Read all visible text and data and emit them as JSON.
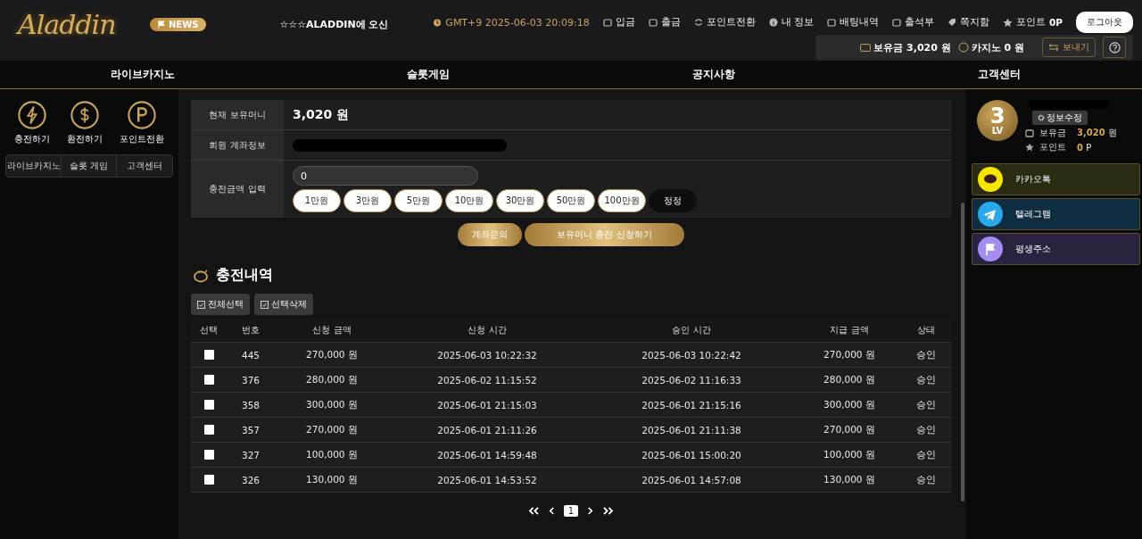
{
  "header": {
    "logo": "Aladdin",
    "news_badge": "NEWS",
    "ticker": "☆☆☆ALADDIN에 오신",
    "clock": "GMT+9 2025-06-03 20:09:18",
    "menu": [
      {
        "label": "입금"
      },
      {
        "label": "출금"
      },
      {
        "label": "포인트전환"
      },
      {
        "label": "내 정보"
      },
      {
        "label": "배팅내역"
      },
      {
        "label": "출석부"
      },
      {
        "label": "쪽지함"
      }
    ],
    "points_label": "포인트",
    "points_value": "0P",
    "logout": "로그아웃",
    "balance_bar": {
      "balance": "보유금 3,020 원",
      "casino": "카지노 0 원",
      "send": "보내기"
    }
  },
  "nav": [
    {
      "label": "라이브카지노"
    },
    {
      "label": "슬롯게임"
    },
    {
      "label": "공지사항"
    },
    {
      "label": "고객센터"
    }
  ],
  "left": {
    "actions": [
      {
        "label": "충전하기"
      },
      {
        "label": "환전하기"
      },
      {
        "label": "포인트전환"
      }
    ],
    "tabs": [
      {
        "label": "라이브카지노"
      },
      {
        "label": "슬롯 게임"
      },
      {
        "label": "고객센터"
      }
    ]
  },
  "form": {
    "balance_label": "현재 보유머니",
    "balance_value": "3,020 원",
    "account_label": "회원 계좌정보",
    "amount_label": "충전금액 입력",
    "amount_value": "0",
    "amount_buttons": [
      {
        "label": "1만원",
        "kind": "amount"
      },
      {
        "label": "3만원",
        "kind": "amount"
      },
      {
        "label": "5만원",
        "kind": "amount"
      },
      {
        "label": "10만원",
        "kind": "amount"
      },
      {
        "label": "30만원",
        "kind": "amount"
      },
      {
        "label": "50만원",
        "kind": "amount"
      },
      {
        "label": "100만원",
        "kind": "amount"
      },
      {
        "label": "정정",
        "kind": "reset"
      }
    ],
    "actions": [
      "계좌문의",
      "보유머니 충전 신청하기"
    ]
  },
  "history": {
    "title": "충전내역",
    "buttons": [
      "전체선택",
      "선택삭제"
    ],
    "columns": [
      "선택",
      "번호",
      "신청 금액",
      "신청 시간",
      "승인 시간",
      "지급 금액",
      "상태"
    ],
    "rows": [
      {
        "checked": false,
        "no": "445",
        "request": "270,000 원",
        "requested_at": "2025-06-03 10:22:32",
        "approved_at": "2025-06-03 10:22:42",
        "paid": "270,000 원",
        "status": "승인"
      },
      {
        "checked": false,
        "no": "376",
        "request": "280,000 원",
        "requested_at": "2025-06-02 11:15:52",
        "approved_at": "2025-06-02 11:16:33",
        "paid": "280,000 원",
        "status": "승인"
      },
      {
        "checked": false,
        "no": "358",
        "request": "300,000 원",
        "requested_at": "2025-06-01 21:15:03",
        "approved_at": "2025-06-01 21:15:16",
        "paid": "300,000 원",
        "status": "승인"
      },
      {
        "checked": false,
        "no": "357",
        "request": "270,000 원",
        "requested_at": "2025-06-01 21:11:26",
        "approved_at": "2025-06-01 21:11:38",
        "paid": "270,000 원",
        "status": "승인"
      },
      {
        "checked": false,
        "no": "327",
        "request": "100,000 원",
        "requested_at": "2025-06-01 14:59:48",
        "approved_at": "2025-06-01 15:00:20",
        "paid": "100,000 원",
        "status": "승인"
      },
      {
        "checked": false,
        "no": "326",
        "request": "130,000 원",
        "requested_at": "2025-06-01 14:53:52",
        "approved_at": "2025-06-01 14:57:08",
        "paid": "130,000 원",
        "status": "승인"
      }
    ],
    "pages": [
      {
        "label": "1",
        "selected": true
      }
    ]
  },
  "profile": {
    "level": "3",
    "level_label": "LV",
    "edit": "정보수정",
    "balance_label": "보유금",
    "balance_value": "3,020",
    "balance_unit": "원",
    "points_label": "포인트",
    "points_value": "0",
    "points_unit": "P"
  },
  "contacts": [
    {
      "label": "카카오톡",
      "kind": "kakao"
    },
    {
      "label": "텔레그램",
      "kind": "telegram"
    },
    {
      "label": "평생주소",
      "kind": "address"
    }
  ]
}
